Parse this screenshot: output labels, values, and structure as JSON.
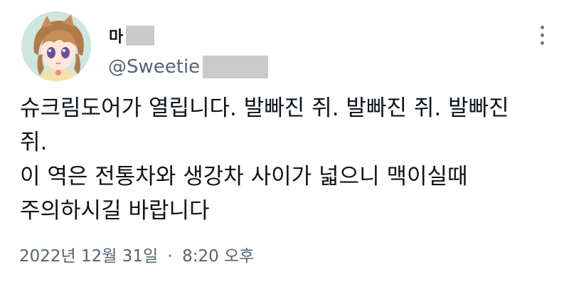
{
  "author": {
    "display_name": "마",
    "handle": "@Sweetie"
  },
  "tweet": {
    "lines": [
      "슈크림도어가 열립니다. 발빠진 쥐. 발빠진 쥐. 발빠진",
      "쥐.",
      "이 역은 전통차와 생강차 사이가 넓으니 맥이실때",
      "주의하시길 바랍니다"
    ]
  },
  "meta": {
    "date": "2022년 12월 31일",
    "separator": "·",
    "time": "8:20 오후"
  },
  "icons": {
    "more": "more-vertical-icon"
  },
  "colors": {
    "text": "#0f1419",
    "secondary": "#536471",
    "redaction": "#c9c9c9",
    "avatar_bg": "#cfe6df"
  }
}
